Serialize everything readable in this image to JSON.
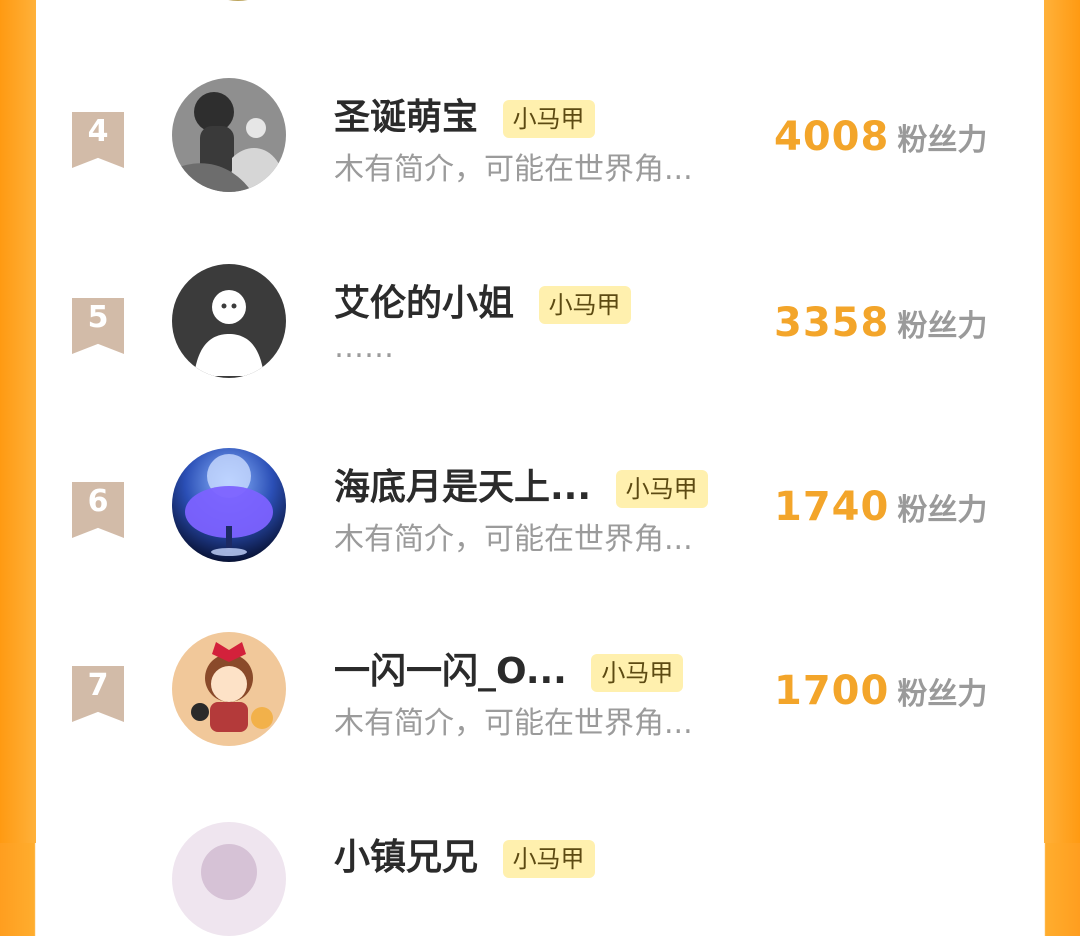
{
  "ranking": {
    "fans_unit": "粉丝力",
    "items": [
      {
        "rank": "4",
        "name": "圣诞萌宝",
        "badge": "小马甲",
        "bio": "木有简介，可能在世界角...",
        "fans": "4008"
      },
      {
        "rank": "5",
        "name": "艾伦的小姐",
        "badge": "小马甲",
        "bio": "……",
        "fans": "3358"
      },
      {
        "rank": "6",
        "name": "海底月是天上...",
        "badge": "小马甲",
        "bio": "木有简介，可能在世界角...",
        "fans": "1740"
      },
      {
        "rank": "7",
        "name": "一闪一闪_O...",
        "badge": "小马甲",
        "bio": "木有简介，可能在世界角...",
        "fans": "1700"
      }
    ],
    "partial_next": {
      "name": "小镇兄兄",
      "badge": "小马甲"
    }
  },
  "colors": {
    "accent_orange": "#ff9e1f",
    "score_orange": "#f3a52a",
    "badge_bg": "#fff0ae",
    "rank_bg": "#d2bba8"
  },
  "icons": [
    "avatar-image",
    "rank-ribbon-icon"
  ]
}
